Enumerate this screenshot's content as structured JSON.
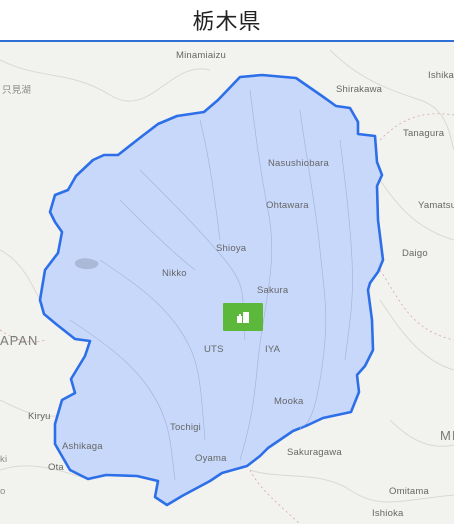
{
  "header": {
    "title": "栃木県"
  },
  "map": {
    "region_fill": "#c8d8fb",
    "region_stroke": "#2c6fe8",
    "marker_color": "#5cb83a",
    "marker_icon": "city-icon",
    "places": {
      "minamiaizu": "Minamiaizu",
      "ishikawa": "Ishika",
      "shirakawa": "Shirakawa",
      "tanagura": "Tanagura",
      "nasushiobara": "Nasushiobara",
      "ohtawara": "Ohtawara",
      "yamatsuri": "Yamatsu",
      "daigo": "Daigo",
      "shioya": "Shioya",
      "nikko": "Nikko",
      "sakura": "Sakura",
      "japan": "APAN",
      "utsunomiya_left": "UTS",
      "utsunomiya_right": "IYA",
      "mooka": "Mooka",
      "kiryu": "Kiryu",
      "tochigi": "Tochigi",
      "ashikaga": "Ashikaga",
      "ota": "Ota",
      "oyama": "Oyama",
      "sakuragawa": "Sakuragawa",
      "omitama": "Omitama",
      "ishioka": "Ishioka",
      "lake_jp": "只見湖",
      "edge_ki": "ki",
      "edge_mi": "MI",
      "edge_o": "o"
    }
  }
}
